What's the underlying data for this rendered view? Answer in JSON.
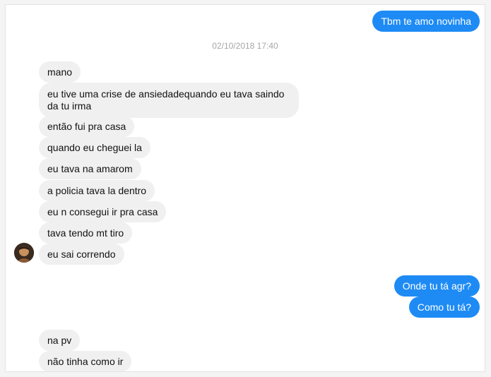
{
  "conversation": {
    "messages_top": [
      {
        "text": "Tbm te amo novinha"
      }
    ],
    "timestamp": "02/10/2018 17:40",
    "incoming": [
      {
        "text": "mano"
      },
      {
        "text": "eu tive uma crise de ansiedadequando eu tava saindo da tu irma"
      },
      {
        "text": "então fui pra casa"
      },
      {
        "text": "quando eu cheguei la"
      },
      {
        "text": "eu tava na amarom"
      },
      {
        "text": "a policia tava la dentro"
      },
      {
        "text": "eu n consegui ir pra casa"
      },
      {
        "text": "tava tendo mt tiro"
      },
      {
        "text": "eu sai correndo"
      }
    ],
    "outgoing": [
      {
        "text": "Onde tu tá agr?"
      },
      {
        "text": "Como tu tá?"
      }
    ],
    "incoming_bottom": [
      {
        "text": "na pv"
      },
      {
        "text": "não tinha como ir"
      }
    ]
  },
  "colors": {
    "outgoing_bubble": "#1e8bf5",
    "incoming_bubble": "#f0f0f0",
    "timestamp": "#a6a6a6"
  },
  "icons": {
    "avatar": "contact-avatar-photo"
  }
}
